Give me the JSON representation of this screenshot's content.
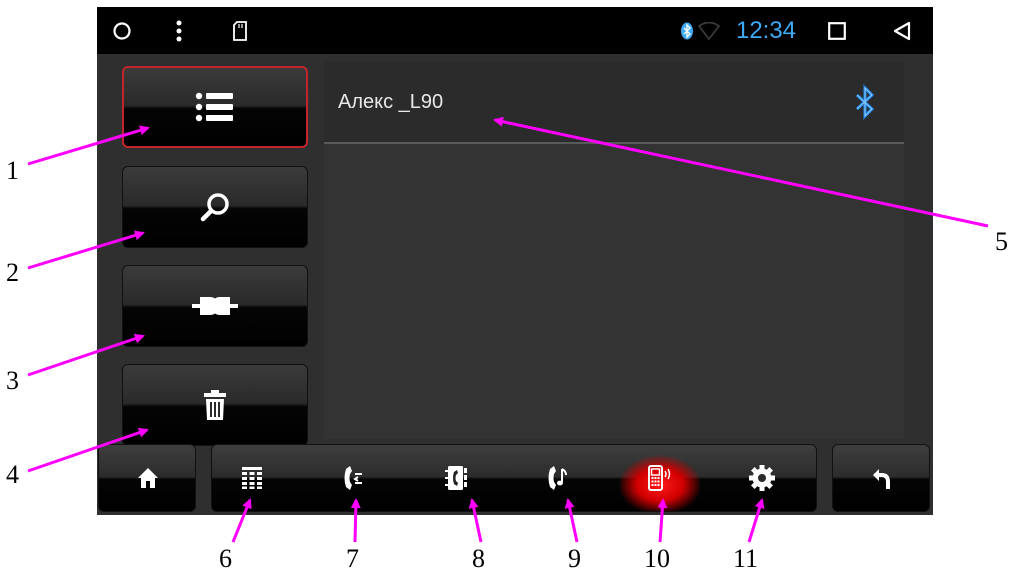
{
  "status_bar": {
    "left_icons": [
      "circle-icon",
      "more-vert-icon",
      "sd-card-icon"
    ],
    "right_icons": [
      "bluetooth-icon",
      "wifi-icon",
      "square-icon",
      "back-triangle-icon"
    ],
    "time": "12:34"
  },
  "sidebar": {
    "items": [
      {
        "icon": "list-icon",
        "active": true
      },
      {
        "icon": "search-icon",
        "active": false
      },
      {
        "icon": "connect-plug-icon",
        "active": false
      },
      {
        "icon": "trash-icon",
        "active": false
      }
    ]
  },
  "device_list": {
    "devices": [
      {
        "name": "Алекс _L90",
        "icon": "bluetooth-icon"
      }
    ]
  },
  "bottom_bar": {
    "home_icon": "home-icon",
    "back_icon": "undo-arrow-icon",
    "tabs": [
      {
        "icon": "dialpad-icon",
        "active": false
      },
      {
        "icon": "call-log-icon",
        "active": false
      },
      {
        "icon": "contacts-icon",
        "active": false
      },
      {
        "icon": "bt-music-icon",
        "active": false
      },
      {
        "icon": "device-pairing-icon",
        "active": true
      },
      {
        "icon": "settings-gear-icon",
        "active": false
      }
    ]
  },
  "callouts": [
    "1",
    "2",
    "3",
    "4",
    "5",
    "6",
    "7",
    "8",
    "9",
    "10",
    "11"
  ],
  "colors": {
    "callout_arrow": "#ff00ff",
    "active_border": "#c2262c",
    "active_tab": "#e00000",
    "time_text": "#3fa9f5",
    "bluetooth": "#1f7fe0"
  }
}
